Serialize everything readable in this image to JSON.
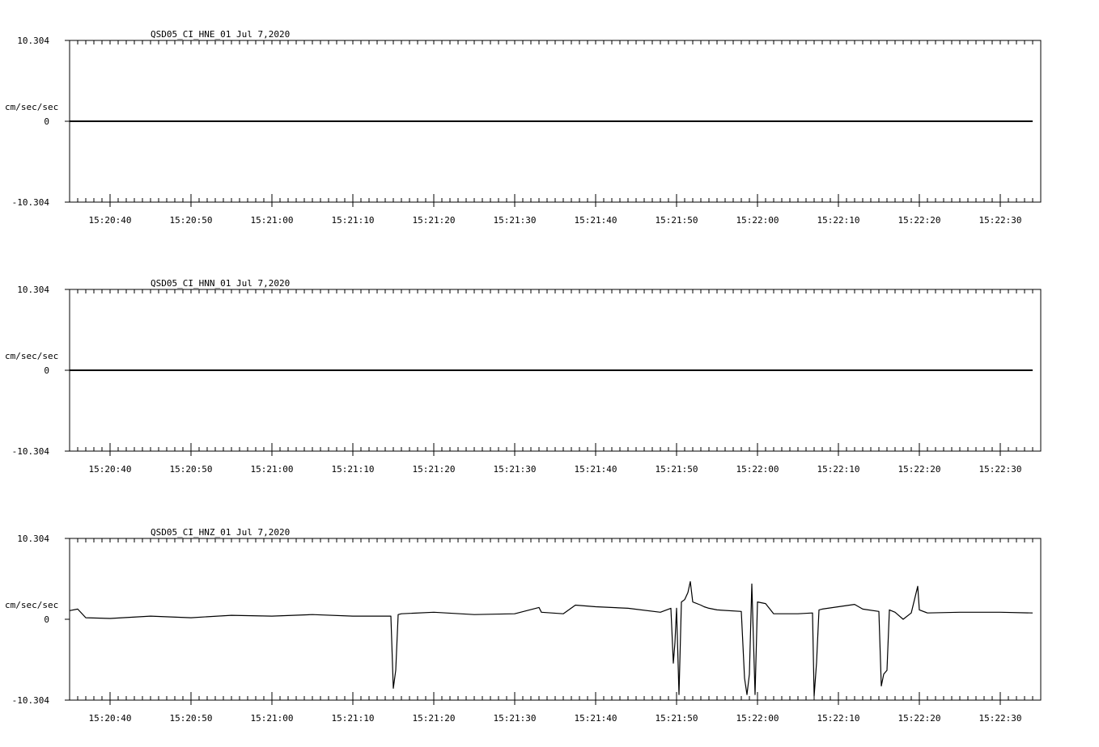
{
  "chart_data": [
    {
      "type": "line",
      "title": "QSD05_CI_HNE_01  Jul 7,2020",
      "ylabel": "cm/sec/sec",
      "ylim": [
        -10.304,
        10.304
      ],
      "y_ticks": [
        {
          "value": 10.304,
          "label": "10.304"
        },
        {
          "value": 0,
          "label": "0"
        },
        {
          "value": -10.304,
          "label": "-10.304"
        }
      ],
      "x_tick_labels": [
        "15:20:40",
        "15:20:50",
        "15:21:00",
        "15:21:10",
        "15:21:20",
        "15:21:30",
        "15:21:40",
        "15:21:50",
        "15:22:00",
        "15:22:10",
        "15:22:20",
        "15:22:30"
      ],
      "series": [
        {
          "x": [
            "15:20:35",
            "15:22:34"
          ],
          "y": [
            0,
            0
          ]
        }
      ]
    },
    {
      "type": "line",
      "title": "QSD05_CI_HNN_01  Jul 7,2020",
      "ylabel": "cm/sec/sec",
      "ylim": [
        -10.304,
        10.304
      ],
      "y_ticks": [
        {
          "value": 10.304,
          "label": "10.304"
        },
        {
          "value": 0,
          "label": "0"
        },
        {
          "value": -10.304,
          "label": "-10.304"
        }
      ],
      "x_tick_labels": [
        "15:20:40",
        "15:20:50",
        "15:21:00",
        "15:21:10",
        "15:21:20",
        "15:21:30",
        "15:21:40",
        "15:21:50",
        "15:22:00",
        "15:22:10",
        "15:22:20",
        "15:22:30"
      ],
      "series": [
        {
          "x": [
            "15:20:35",
            "15:22:34"
          ],
          "y": [
            0,
            0
          ]
        }
      ]
    },
    {
      "type": "line",
      "title": "QSD05_CI_HNZ_01  Jul 7,2020",
      "ylabel": "cm/sec/sec",
      "ylim": [
        -10.304,
        10.304
      ],
      "y_ticks": [
        {
          "value": 10.304,
          "label": "10.304"
        },
        {
          "value": 0,
          "label": "0"
        },
        {
          "value": -10.304,
          "label": "-10.304"
        }
      ],
      "x_tick_labels": [
        "15:20:40",
        "15:20:50",
        "15:21:00",
        "15:21:10",
        "15:21:20",
        "15:21:30",
        "15:21:40",
        "15:21:50",
        "15:22:00",
        "15:22:10",
        "15:22:20",
        "15:22:30"
      ],
      "series": [
        {
          "x": [
            "15:20:35",
            "15:20:36",
            "15:20:37",
            "15:20:40",
            "15:20:45",
            "15:20:50",
            "15:20:55",
            "15:21:00",
            "15:21:05",
            "15:21:10",
            "15:21:14.7",
            "15:21:15",
            "15:21:15.3",
            "15:21:15.6",
            "15:21:16",
            "15:21:20",
            "15:21:25",
            "15:21:30",
            "15:21:33",
            "15:21:33.3",
            "15:21:36",
            "15:21:37.5",
            "15:21:40",
            "15:21:44",
            "15:21:48",
            "15:21:49.3",
            "15:21:49.6",
            "15:21:49.8",
            "15:21:50",
            "15:21:50.3",
            "15:21:50.6",
            "15:21:51",
            "15:21:51.4",
            "15:21:51.7",
            "15:21:52",
            "15:21:53",
            "15:21:53.4",
            "15:21:54",
            "15:21:55",
            "15:21:58",
            "15:21:58.4",
            "15:21:58.7",
            "15:21:59",
            "15:21:59.3",
            "15:21:59.7",
            "15:22:00",
            "15:22:01",
            "15:22:02",
            "15:22:05",
            "15:22:06.8",
            "15:22:07",
            "15:22:07.3",
            "15:22:07.6",
            "15:22:08",
            "15:22:10",
            "15:22:12",
            "15:22:13",
            "15:22:15",
            "15:22:15.3",
            "15:22:15.6",
            "15:22:16",
            "15:22:16.3",
            "15:22:17",
            "15:22:18",
            "15:22:19",
            "15:22:19.8",
            "15:22:20",
            "15:22:21",
            "15:22:25",
            "15:22:30",
            "15:22:34"
          ],
          "y": [
            1.1,
            1.3,
            0.2,
            0.1,
            0.4,
            0.2,
            0.5,
            0.4,
            0.6,
            0.4,
            0.4,
            -8.8,
            -6.5,
            0.6,
            0.7,
            0.9,
            0.6,
            0.7,
            1.5,
            0.9,
            0.7,
            1.8,
            1.6,
            1.4,
            0.9,
            1.4,
            -5.6,
            -3.0,
            1.4,
            -9.6,
            2.2,
            2.5,
            3.4,
            4.8,
            2.2,
            1.8,
            1.6,
            1.4,
            1.2,
            1.0,
            -7.5,
            -9.6,
            -7.0,
            4.5,
            -9.6,
            2.2,
            2.0,
            0.7,
            0.7,
            0.8,
            -9.8,
            -5.5,
            1.2,
            1.3,
            1.6,
            1.9,
            1.3,
            1.0,
            -8.5,
            -7.0,
            -6.5,
            1.2,
            0.9,
            0.0,
            0.8,
            4.2,
            1.2,
            0.8,
            0.9,
            0.9,
            0.8
          ]
        }
      ]
    }
  ]
}
